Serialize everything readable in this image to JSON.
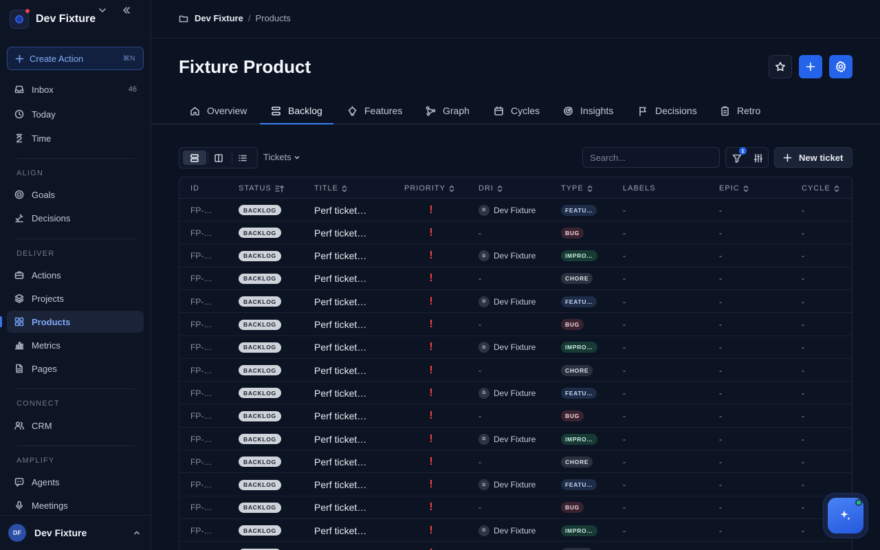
{
  "sidebar": {
    "workspace": "Dev Fixture",
    "create_action": {
      "label": "Create Action",
      "shortcut": "⌘N"
    },
    "top_items": [
      {
        "label": "Inbox",
        "count": "46",
        "icon": "inbox-icon"
      },
      {
        "label": "Today",
        "icon": "clock-icon"
      },
      {
        "label": "Time",
        "icon": "hourglass-icon"
      }
    ],
    "sections": {
      "align": {
        "title": "ALIGN",
        "items": [
          {
            "label": "Goals",
            "icon": "target-icon"
          },
          {
            "label": "Decisions",
            "icon": "scale-icon"
          }
        ]
      },
      "deliver": {
        "title": "DELIVER",
        "items": [
          {
            "label": "Actions",
            "icon": "briefcase-icon"
          },
          {
            "label": "Projects",
            "icon": "layers-icon"
          },
          {
            "label": "Products",
            "icon": "grid-icon"
          },
          {
            "label": "Metrics",
            "icon": "bar-chart-icon"
          },
          {
            "label": "Pages",
            "icon": "file-icon"
          }
        ]
      },
      "connect": {
        "title": "CONNECT",
        "items": [
          {
            "label": "CRM",
            "icon": "users-icon"
          }
        ]
      },
      "amplify": {
        "title": "AMPLIFY",
        "items": [
          {
            "label": "Agents",
            "icon": "chat-bot-icon"
          },
          {
            "label": "Meetings",
            "icon": "mic-icon"
          }
        ]
      }
    },
    "active_item": "Products",
    "user": {
      "initials": "DF",
      "name": "Dev Fixture"
    }
  },
  "breadcrumb": {
    "root": "Dev Fixture",
    "separator": "/",
    "current": "Products"
  },
  "page": {
    "title": "Fixture Product"
  },
  "tabs": [
    {
      "label": "Overview",
      "icon": "home-icon"
    },
    {
      "label": "Backlog",
      "icon": "stack-icon",
      "active": true
    },
    {
      "label": "Features",
      "icon": "lightbulb-icon"
    },
    {
      "label": "Graph",
      "icon": "graph-icon"
    },
    {
      "label": "Cycles",
      "icon": "calendar-icon"
    },
    {
      "label": "Insights",
      "icon": "radar-icon"
    },
    {
      "label": "Decisions",
      "icon": "flag-icon"
    },
    {
      "label": "Retro",
      "icon": "clipboard-icon"
    }
  ],
  "toolbar": {
    "view_dropdown": "Tickets",
    "search_placeholder": "Search...",
    "filter_count": "1",
    "new_ticket": "New ticket"
  },
  "table": {
    "columns": [
      "ID",
      "STATUS",
      "TITLE",
      "PRIORITY",
      "DRI",
      "TYPE",
      "LABELS",
      "EPIC",
      "CYCLE"
    ],
    "rows": [
      {
        "id": "FP-…",
        "status": "BACKLOG",
        "title": "Perf ticket…",
        "priority": "!",
        "dri": "Dev Fixture",
        "dri_initial": "D",
        "type": "FEATU…",
        "type_kind": "feature",
        "labels": "-",
        "epic": "-",
        "cycle": "-"
      },
      {
        "id": "FP-…",
        "status": "BACKLOG",
        "title": "Perf ticket…",
        "priority": "!",
        "dri": "-",
        "dri_initial": "",
        "type": "BUG",
        "type_kind": "bug",
        "labels": "-",
        "epic": "-",
        "cycle": "-"
      },
      {
        "id": "FP-…",
        "status": "BACKLOG",
        "title": "Perf ticket…",
        "priority": "!",
        "dri": "Dev Fixture",
        "dri_initial": "D",
        "type": "IMPRO…",
        "type_kind": "improvement",
        "labels": "-",
        "epic": "-",
        "cycle": "-"
      },
      {
        "id": "FP-…",
        "status": "BACKLOG",
        "title": "Perf ticket…",
        "priority": "!",
        "dri": "-",
        "dri_initial": "",
        "type": "CHORE",
        "type_kind": "chore",
        "labels": "-",
        "epic": "-",
        "cycle": "-"
      },
      {
        "id": "FP-…",
        "status": "BACKLOG",
        "title": "Perf ticket…",
        "priority": "!",
        "dri": "Dev Fixture",
        "dri_initial": "D",
        "type": "FEATU…",
        "type_kind": "feature",
        "labels": "-",
        "epic": "-",
        "cycle": "-"
      },
      {
        "id": "FP-…",
        "status": "BACKLOG",
        "title": "Perf ticket…",
        "priority": "!",
        "dri": "-",
        "dri_initial": "",
        "type": "BUG",
        "type_kind": "bug",
        "labels": "-",
        "epic": "-",
        "cycle": "-"
      },
      {
        "id": "FP-…",
        "status": "BACKLOG",
        "title": "Perf ticket…",
        "priority": "!",
        "dri": "Dev Fixture",
        "dri_initial": "D",
        "type": "IMPRO…",
        "type_kind": "improvement",
        "labels": "-",
        "epic": "-",
        "cycle": "-"
      },
      {
        "id": "FP-…",
        "status": "BACKLOG",
        "title": "Perf ticket…",
        "priority": "!",
        "dri": "-",
        "dri_initial": "",
        "type": "CHORE",
        "type_kind": "chore",
        "labels": "-",
        "epic": "-",
        "cycle": "-"
      },
      {
        "id": "FP-…",
        "status": "BACKLOG",
        "title": "Perf ticket…",
        "priority": "!",
        "dri": "Dev Fixture",
        "dri_initial": "D",
        "type": "FEATU…",
        "type_kind": "feature",
        "labels": "-",
        "epic": "-",
        "cycle": "-"
      },
      {
        "id": "FP-…",
        "status": "BACKLOG",
        "title": "Perf ticket…",
        "priority": "!",
        "dri": "-",
        "dri_initial": "",
        "type": "BUG",
        "type_kind": "bug",
        "labels": "-",
        "epic": "-",
        "cycle": "-"
      },
      {
        "id": "FP-…",
        "status": "BACKLOG",
        "title": "Perf ticket…",
        "priority": "!",
        "dri": "Dev Fixture",
        "dri_initial": "D",
        "type": "IMPRO…",
        "type_kind": "improvement",
        "labels": "-",
        "epic": "-",
        "cycle": "-"
      },
      {
        "id": "FP-…",
        "status": "BACKLOG",
        "title": "Perf ticket…",
        "priority": "!",
        "dri": "-",
        "dri_initial": "",
        "type": "CHORE",
        "type_kind": "chore",
        "labels": "-",
        "epic": "-",
        "cycle": "-"
      },
      {
        "id": "FP-…",
        "status": "BACKLOG",
        "title": "Perf ticket…",
        "priority": "!",
        "dri": "Dev Fixture",
        "dri_initial": "D",
        "type": "FEATU…",
        "type_kind": "feature",
        "labels": "-",
        "epic": "-",
        "cycle": "-"
      },
      {
        "id": "FP-…",
        "status": "BACKLOG",
        "title": "Perf ticket…",
        "priority": "!",
        "dri": "-",
        "dri_initial": "",
        "type": "BUG",
        "type_kind": "bug",
        "labels": "-",
        "epic": "-",
        "cycle": "-"
      },
      {
        "id": "FP-…",
        "status": "BACKLOG",
        "title": "Perf ticket…",
        "priority": "!",
        "dri": "Dev Fixture",
        "dri_initial": "D",
        "type": "IMPRO…",
        "type_kind": "improvement",
        "labels": "-",
        "epic": "-",
        "cycle": "-"
      },
      {
        "id": "FP-…",
        "status": "BACKLOG",
        "title": "Perf ticket…",
        "priority": "!",
        "dri": "-",
        "dri_initial": "",
        "type": "CHORE",
        "type_kind": "chore",
        "labels": "-",
        "epic": "-",
        "cycle": "-"
      }
    ]
  },
  "colors": {
    "accent": "#2563eb",
    "background": "#0b1222",
    "priority_urgent": "#ef4444"
  }
}
